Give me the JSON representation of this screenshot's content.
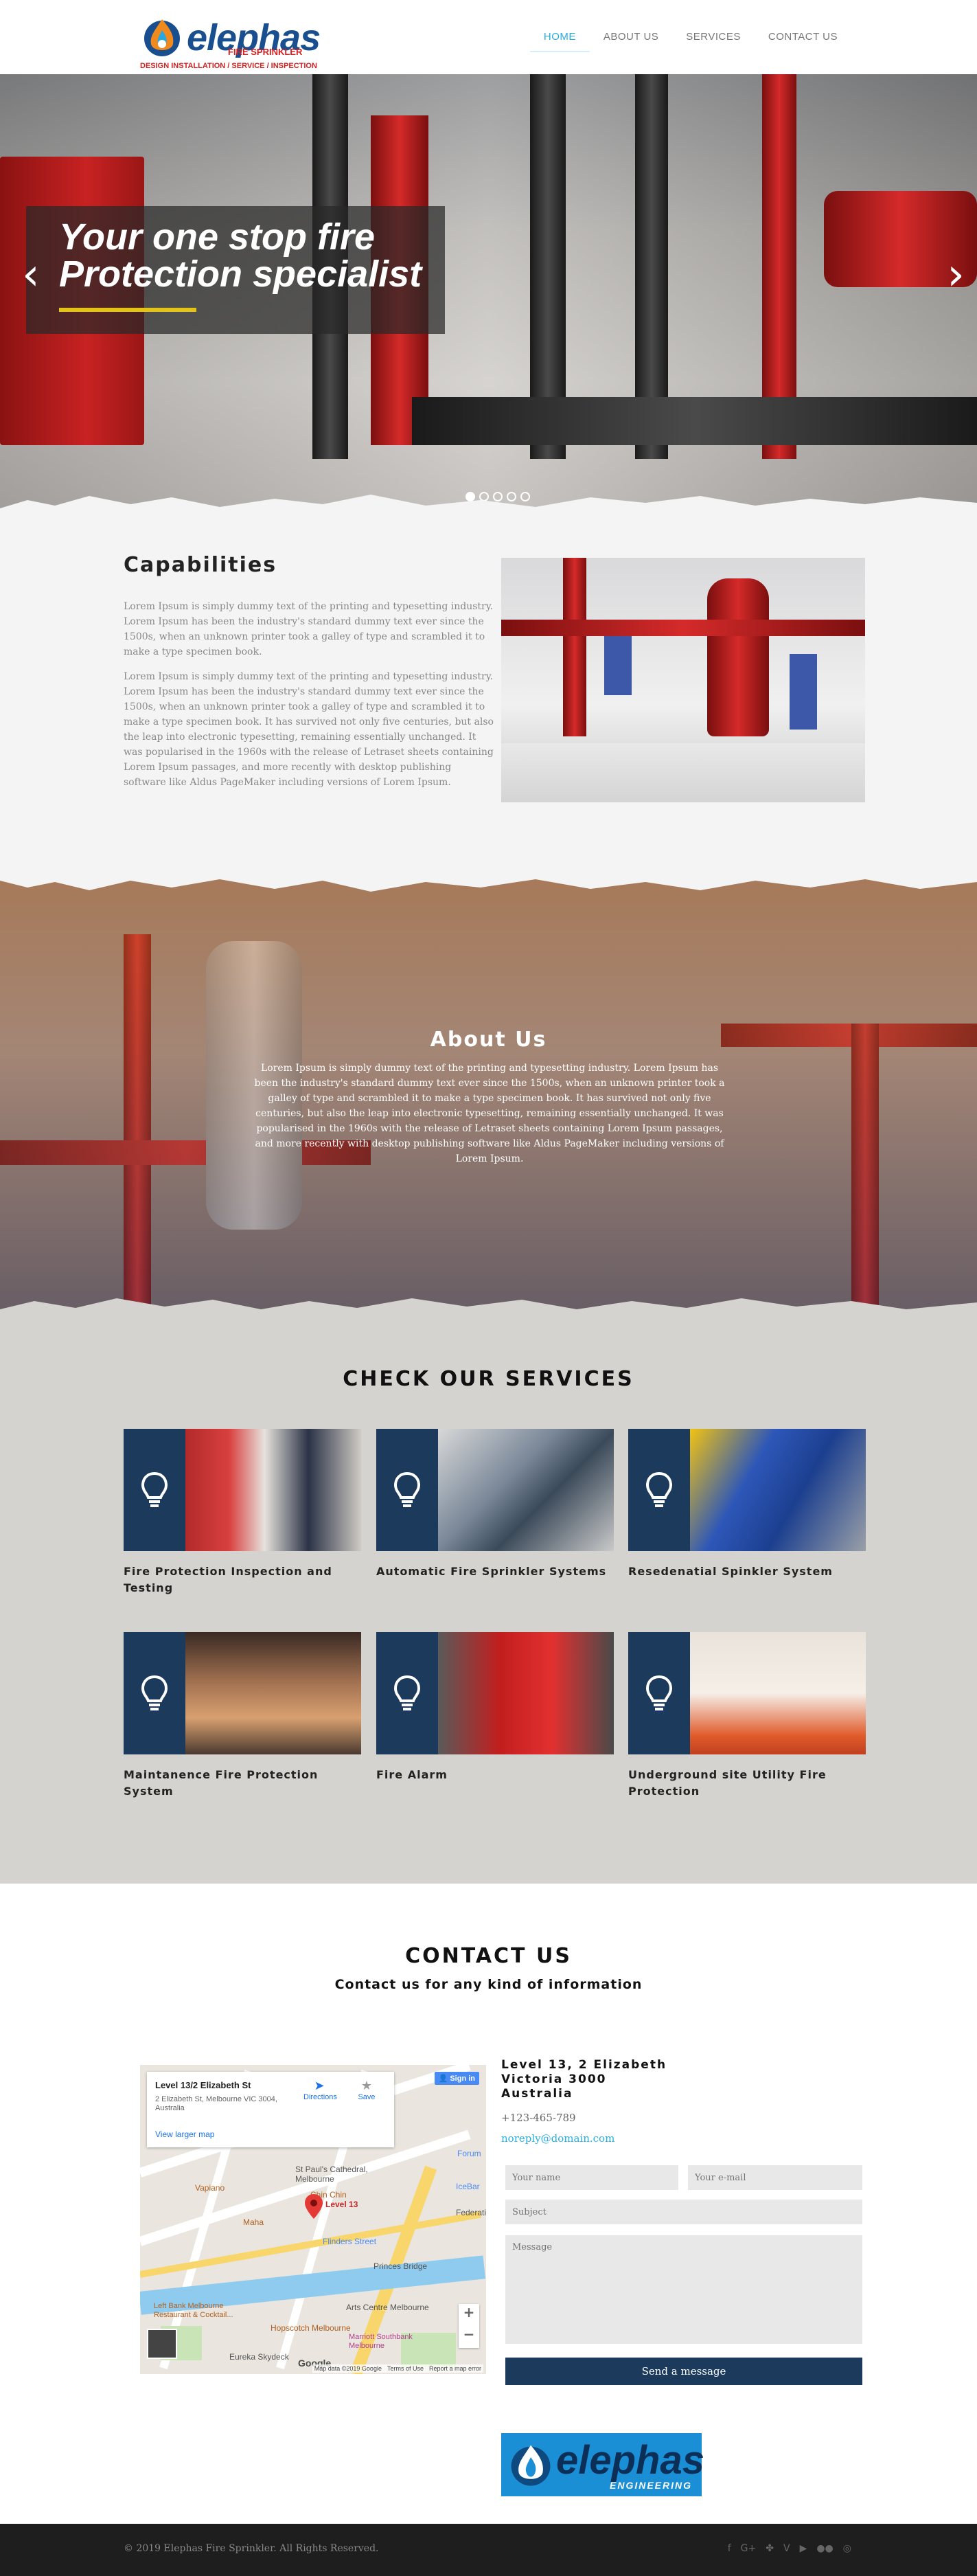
{
  "header": {
    "logo_word": "elephas",
    "logo_sub": "FIRE SPRINKLER",
    "logo_tagline": "DESIGN INSTALLATION / SERVICE / INSPECTION",
    "nav": [
      {
        "label": "HOME"
      },
      {
        "label": "ABOUT US"
      },
      {
        "label": "SERVICES"
      },
      {
        "label": "CONTACT US"
      }
    ]
  },
  "hero": {
    "title_line1": "Your one stop fire",
    "title_line2": "Protection specialist",
    "prev_icon": "chevron-left",
    "next_icon": "chevron-right",
    "slides_total": 5,
    "active_slide": 1
  },
  "capabilities": {
    "title": "Capabilities",
    "para1": "Lorem Ipsum is simply dummy text of the printing and typesetting industry. Lorem Ipsum has been the industry's standard dummy text ever since the 1500s, when an unknown printer took a galley of type and scrambled it to make a type specimen book.",
    "para2": "Lorem Ipsum is simply dummy text of the printing and typesetting industry. Lorem Ipsum has been the industry's standard dummy text ever since the 1500s, when an unknown printer took a galley of type and scrambled it to make a type specimen book. It has survived not only five centuries, but also the leap into electronic typesetting, remaining essentially unchanged. It was popularised in the 1960s with the release of Letraset sheets containing Lorem Ipsum passages, and more recently with desktop publishing software like Aldus PageMaker including versions of Lorem Ipsum."
  },
  "about": {
    "title": "About Us",
    "text": "Lorem Ipsum is simply dummy text of the printing and typesetting industry. Lorem Ipsum has been the industry's standard dummy text ever since the 1500s, when an unknown printer took a galley of type and scrambled it to make a type specimen book. It has survived not only five centuries, but also the leap into electronic typesetting, remaining essentially unchanged. It was popularised in the 1960s with the release of Letraset sheets containing Lorem Ipsum passages, and more recently with desktop publishing software like Aldus PageMaker including versions of Lorem Ipsum."
  },
  "services": {
    "title": "CHECK OUR SERVICES",
    "icon": "lightbulb-icon",
    "items": [
      {
        "name": "Fire Protection Inspection and Testing"
      },
      {
        "name": "Automatic Fire Sprinkler Systems"
      },
      {
        "name": "Resedenatial Spinkler System"
      },
      {
        "name": "Maintanence Fire Protection System"
      },
      {
        "name": "Fire Alarm"
      },
      {
        "name": "Underground site Utility Fire Protection"
      }
    ]
  },
  "contact": {
    "title": "CONTACT US",
    "subtitle": "Contact us for any kind of information",
    "map": {
      "place_title": "Level 13/2 Elizabeth St",
      "place_address": "2 Elizabeth St, Melbourne VIC 3004, Australia",
      "directions": "Directions",
      "save": "Save",
      "larger_map": "View larger map",
      "sign_in": "Sign in",
      "pin_label": "Level 13",
      "labels": [
        "Chin Chin",
        "Forum",
        "St Paul's Cathedral, Melbourne",
        "IceBar",
        "Federatio",
        "Vapiano",
        "Maha",
        "Flinders Street",
        "Princes Bridge",
        "Arts Centre Melbourne",
        "Left Bank Melbourne Restaurant & Cocktail...",
        "Hopscotch Melbourne",
        "Eureka Skydeck",
        "Marriott Southbank Melbourne",
        "Google"
      ],
      "attribution": "Map data ©2019 Google",
      "terms": "Terms of Use",
      "report": "Report a map error",
      "zoom_in": "+",
      "zoom_out": "−"
    },
    "address_line1": "Level 13, 2 Elizabeth",
    "address_line2": "Victoria 3000",
    "address_line3": "Australia",
    "phone": "+123-465-789",
    "email": "noreply@domain.com",
    "form": {
      "name_placeholder": "Your name",
      "email_placeholder": "Your e-mail",
      "subject_placeholder": "Subject",
      "message_placeholder": "Message",
      "send_label": "Send a message"
    },
    "bottom_logo_word": "elephas",
    "bottom_logo_sub": "ENGINEERING"
  },
  "footer": {
    "copyright": "© 2019 Elephas Fire Sprinkler. All Rights Reserved.",
    "social": [
      {
        "label": "f",
        "icon": "facebook-icon"
      },
      {
        "label": "G+",
        "icon": "google-plus-icon"
      },
      {
        "label": "✤",
        "icon": "yelp-icon"
      },
      {
        "label": "V",
        "icon": "vimeo-icon"
      },
      {
        "label": "▶",
        "icon": "youtube-icon"
      },
      {
        "label": "●●",
        "icon": "flickr-icon"
      },
      {
        "label": "◎",
        "icon": "instagram-icon"
      }
    ]
  },
  "colors": {
    "accent": "#27aee0",
    "navy": "#1b3a5c",
    "brand_red": "#d32020",
    "brand_blue": "#1a4f8f"
  }
}
